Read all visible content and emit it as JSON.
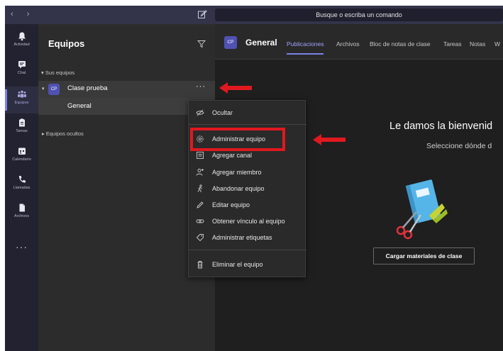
{
  "titlebar": {
    "nav_back": "‹",
    "nav_forward": "›",
    "search_placeholder": "Busque o escriba un comando"
  },
  "appbar": {
    "items": [
      {
        "label": "Actividad",
        "icon": "bell-icon"
      },
      {
        "label": "Chat",
        "icon": "chat-icon"
      },
      {
        "label": "Equipos",
        "icon": "teams-icon",
        "active": true
      },
      {
        "label": "Tareas",
        "icon": "assignments-icon"
      },
      {
        "label": "Calendario",
        "icon": "calendar-icon"
      },
      {
        "label": "Llamadas",
        "icon": "phone-icon"
      },
      {
        "label": "Archivos",
        "icon": "files-icon"
      }
    ],
    "more": "···"
  },
  "panel": {
    "title": "Equipos",
    "section_your_teams": "▾ Sus equipos",
    "team": {
      "avatar": "CP",
      "name": "Clase prueba",
      "more": "···"
    },
    "channel": {
      "name": "General"
    },
    "section_hidden": "▸ Equipos ocultos"
  },
  "main": {
    "channel_avatar": "CP",
    "channel_title": "General",
    "tabs": [
      "Publicaciones",
      "Archivos",
      "Bloc de notas de clase",
      "Tareas",
      "Notas",
      "W"
    ],
    "welcome": "Le damos la bienvenid",
    "subtitle": "Seleccione dónde d",
    "upload_button": "Cargar materiales de clase"
  },
  "context_menu": {
    "hide": "Ocultar",
    "items": [
      "Administrar equipo",
      "Agregar canal",
      "Agregar miembro",
      "Abandonar equipo",
      "Editar equipo",
      "Obtener vínculo al equipo",
      "Administrar etiquetas"
    ],
    "delete": "Eliminar el equipo"
  },
  "colors": {
    "accent": "#7b83eb",
    "annotation_red": "#e0191f",
    "titlebar": "#33344a"
  }
}
